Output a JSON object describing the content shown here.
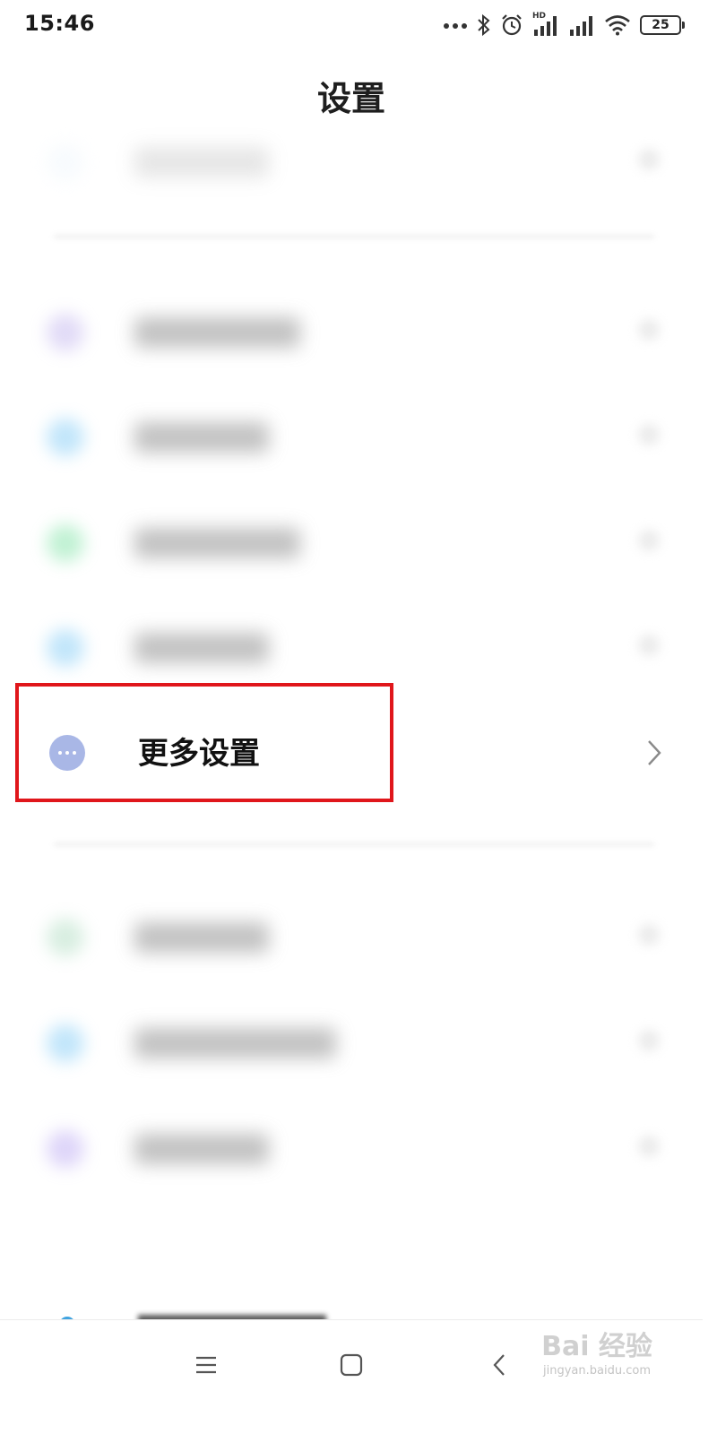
{
  "status_bar": {
    "time": "15:46",
    "network_label": "HD",
    "battery_level": "25",
    "icons": [
      "more-dots-icon",
      "bluetooth-icon",
      "alarm-icon",
      "hd-signal-icon",
      "signal-icon",
      "wifi-icon",
      "battery-icon"
    ]
  },
  "header": {
    "title": "设置"
  },
  "settings": {
    "highlighted_item": {
      "label": "更多设置",
      "icon": "more-dots-icon"
    }
  },
  "nav_bar": {
    "buttons": [
      "menu-icon",
      "home-icon",
      "back-icon"
    ]
  },
  "watermark": {
    "main": "Bai 经验",
    "sub": "jingyan.baidu.com"
  },
  "colors": {
    "highlight_border": "#e0161b",
    "more_icon": "#a9b7e6",
    "partial_icon": "#3fa3e0",
    "blurred_icon_colors": [
      "#eaf3fb",
      "#c9bdf0",
      "#8fd1f7",
      "#8ee6b0",
      "#8fd1f7",
      "#b8e0c8",
      "#8fd1f7",
      "#c3b3f4"
    ]
  }
}
